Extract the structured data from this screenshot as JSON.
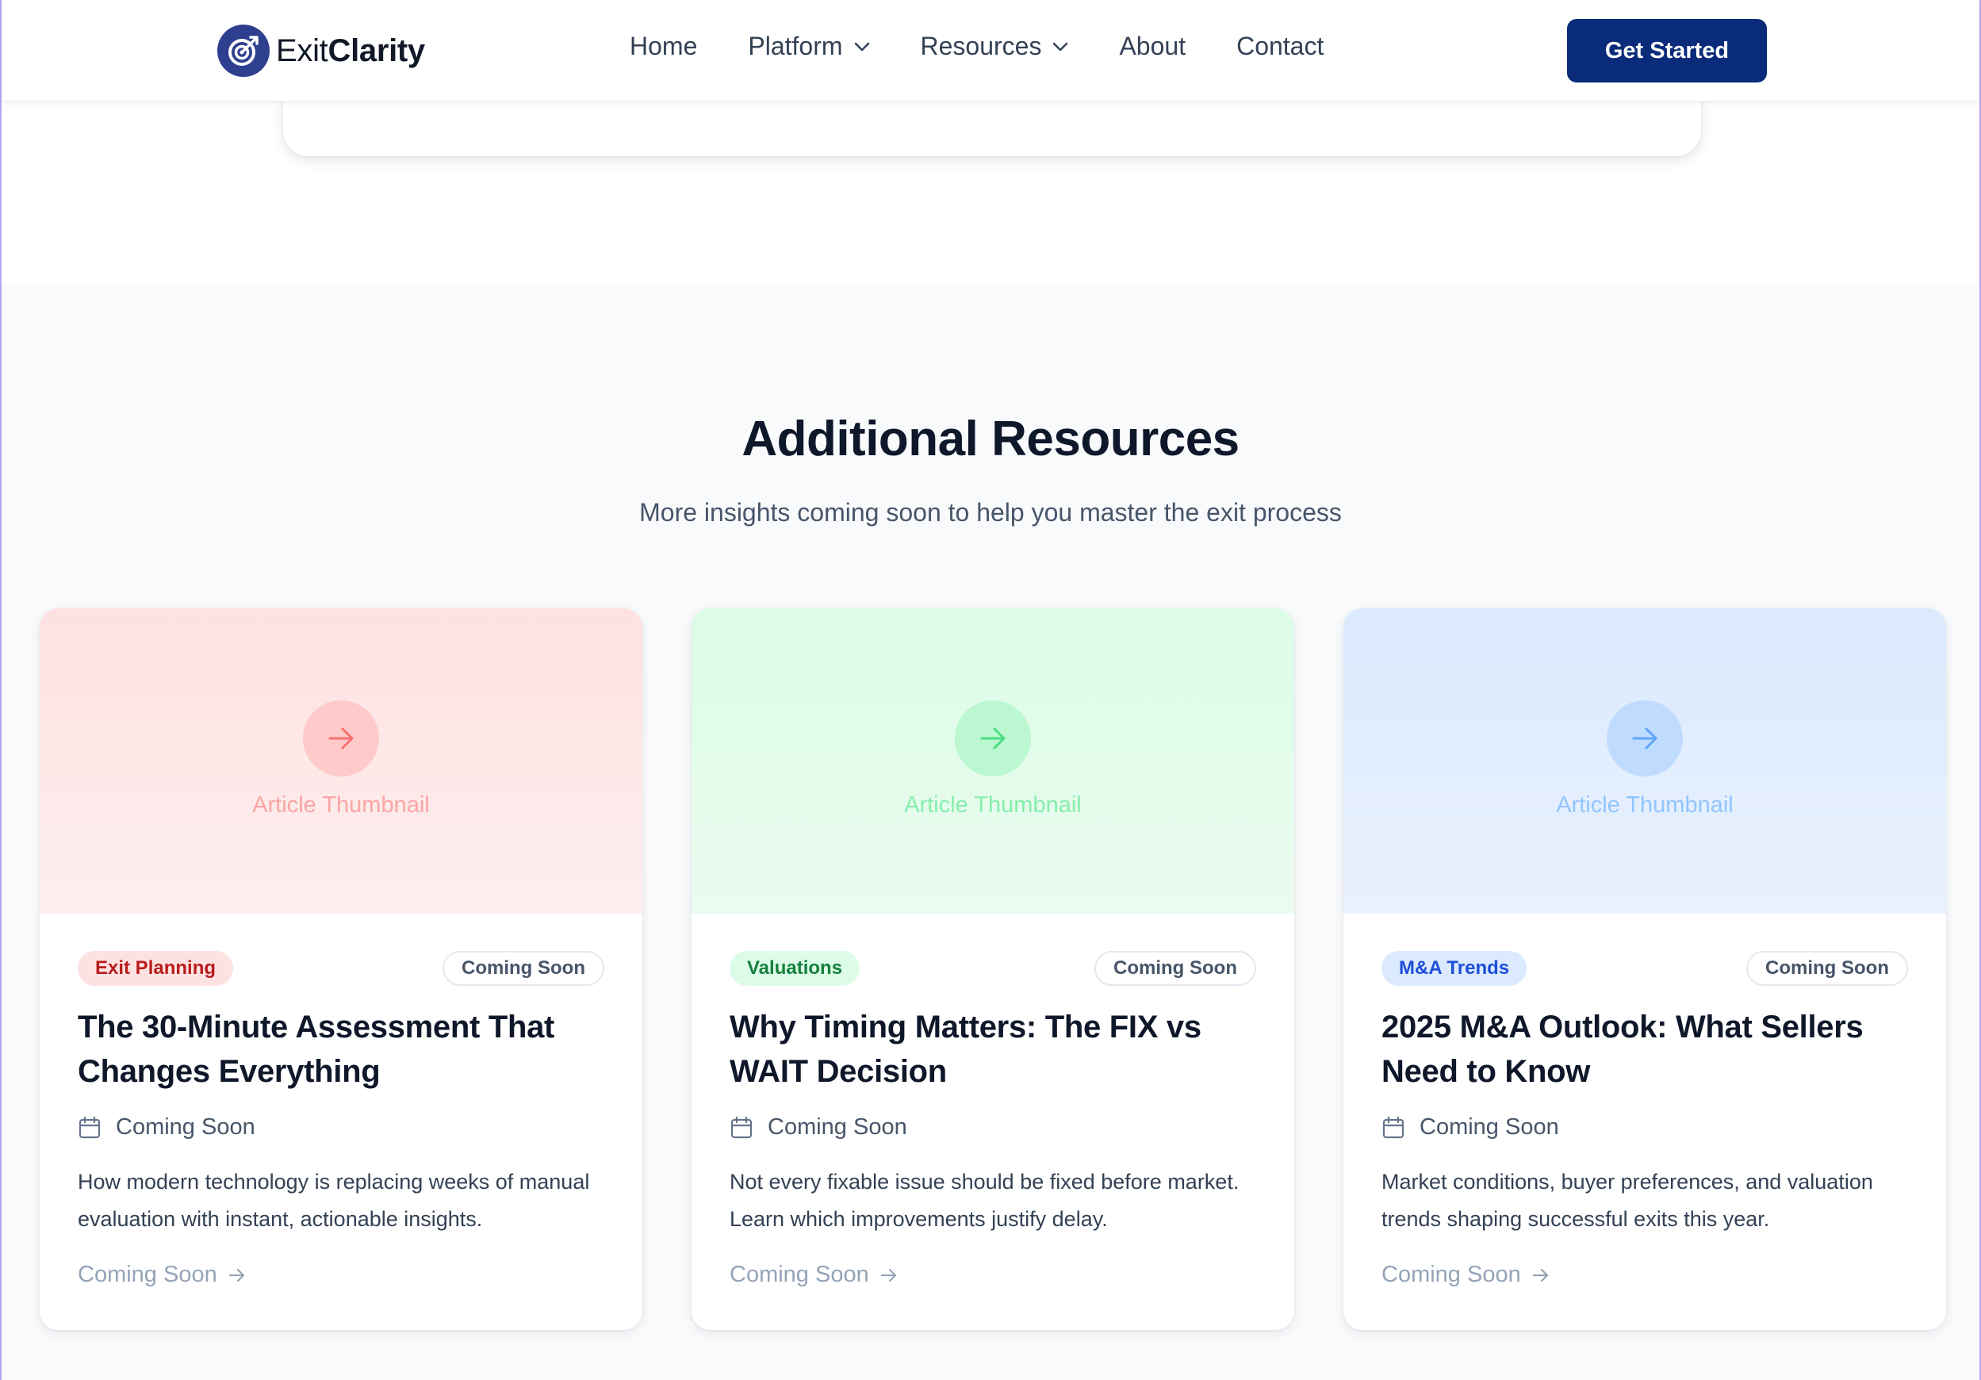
{
  "brand": {
    "name_regular": "Exit",
    "name_bold": "Clarity",
    "logo_icon": "target-arrow-icon",
    "color": "#2f3f8f"
  },
  "nav": {
    "items": [
      {
        "label": "Home",
        "has_dropdown": false
      },
      {
        "label": "Platform",
        "has_dropdown": true
      },
      {
        "label": "Resources",
        "has_dropdown": true
      },
      {
        "label": "About",
        "has_dropdown": false
      },
      {
        "label": "Contact",
        "has_dropdown": false
      }
    ],
    "cta_label": "Get Started",
    "cta_color": "#0a2b7a"
  },
  "section": {
    "title": "Additional Resources",
    "subtitle": "More insights coming soon to help you master the exit process"
  },
  "cards": [
    {
      "thumbnail_label": "Article Thumbnail",
      "category": "Exit Planning",
      "status": "Coming Soon",
      "title": "The 30-Minute Assessment That Changes Everything",
      "date": "Coming Soon",
      "description": "How modern technology is replacing weeks of manual evaluation with instant, actionable insights.",
      "link_label": "Coming Soon",
      "accent": "#b91c1c"
    },
    {
      "thumbnail_label": "Article Thumbnail",
      "category": "Valuations",
      "status": "Coming Soon",
      "title": "Why Timing Matters: The FIX vs WAIT Decision",
      "date": "Coming Soon",
      "description": "Not every fixable issue should be fixed before market. Learn which improvements justify delay.",
      "link_label": "Coming Soon",
      "accent": "#15803d"
    },
    {
      "thumbnail_label": "Article Thumbnail",
      "category": "M&A Trends",
      "status": "Coming Soon",
      "title": "2025 M&A Outlook: What Sellers Need to Know",
      "date": "Coming Soon",
      "description": "Market conditions, buyer preferences, and valuation trends shaping successful exits this year.",
      "link_label": "Coming Soon",
      "accent": "#1d4ed8"
    }
  ]
}
